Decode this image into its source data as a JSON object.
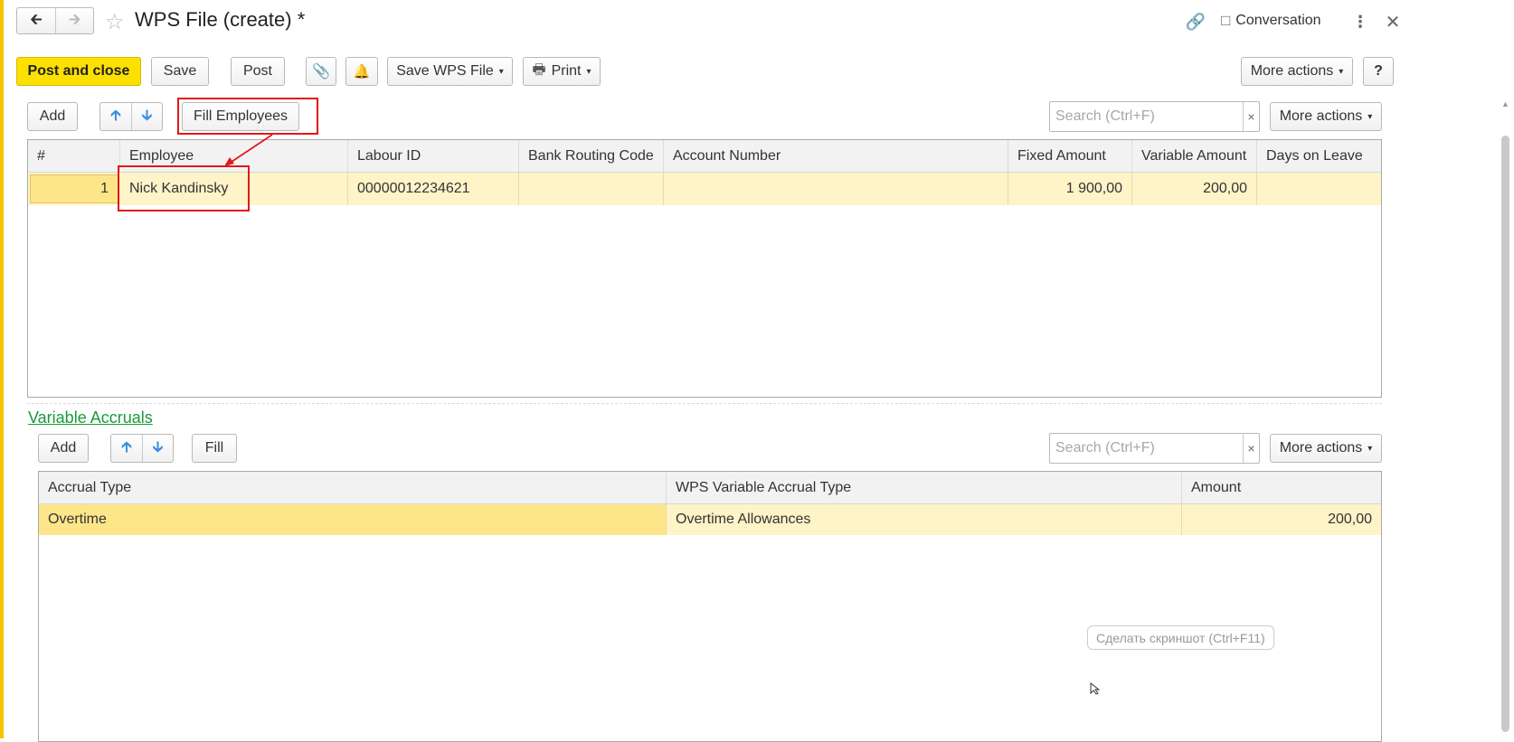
{
  "window": {
    "title": "WPS File (create) *",
    "conversation_label": "Conversation"
  },
  "toolbar": {
    "post_and_close": "Post and close",
    "save": "Save",
    "post": "Post",
    "save_wps_file": "Save WPS File",
    "print": "Print",
    "more_actions": "More actions",
    "help": "?"
  },
  "employees_section": {
    "add": "Add",
    "fill_employees": "Fill Employees",
    "search_placeholder": "Search (Ctrl+F)",
    "more_actions": "More actions",
    "columns": [
      "#",
      "Employee",
      "Labour ID",
      "Bank Routing Code",
      "Account Number",
      "Fixed Amount",
      "Variable Amount",
      "Days on Leave"
    ],
    "rows": [
      {
        "num": "1",
        "employee": "Nick Kandinsky",
        "labour_id": "00000012234621",
        "bank_routing_code": "",
        "account_number": "",
        "fixed_amount": "1 900,00",
        "variable_amount": "200,00",
        "days_on_leave": ""
      }
    ]
  },
  "variable_accruals": {
    "title": "Variable Accruals",
    "add": "Add",
    "fill": "Fill",
    "search_placeholder": "Search (Ctrl+F)",
    "more_actions": "More actions",
    "columns": [
      "Accrual Type",
      "WPS Variable Accrual Type",
      "Amount"
    ],
    "rows": [
      {
        "accrual_type": "Overtime",
        "wps_type": "Overtime Allowances",
        "amount": "200,00"
      }
    ]
  },
  "tooltip": "Сделать скриншот (Ctrl+F11)",
  "colors": {
    "primary_button": "#fce000",
    "selected_row": "#fff3c8",
    "selected_cell": "#fde68a",
    "link_green": "#1a9a3a",
    "annotation_red": "#e21818"
  }
}
